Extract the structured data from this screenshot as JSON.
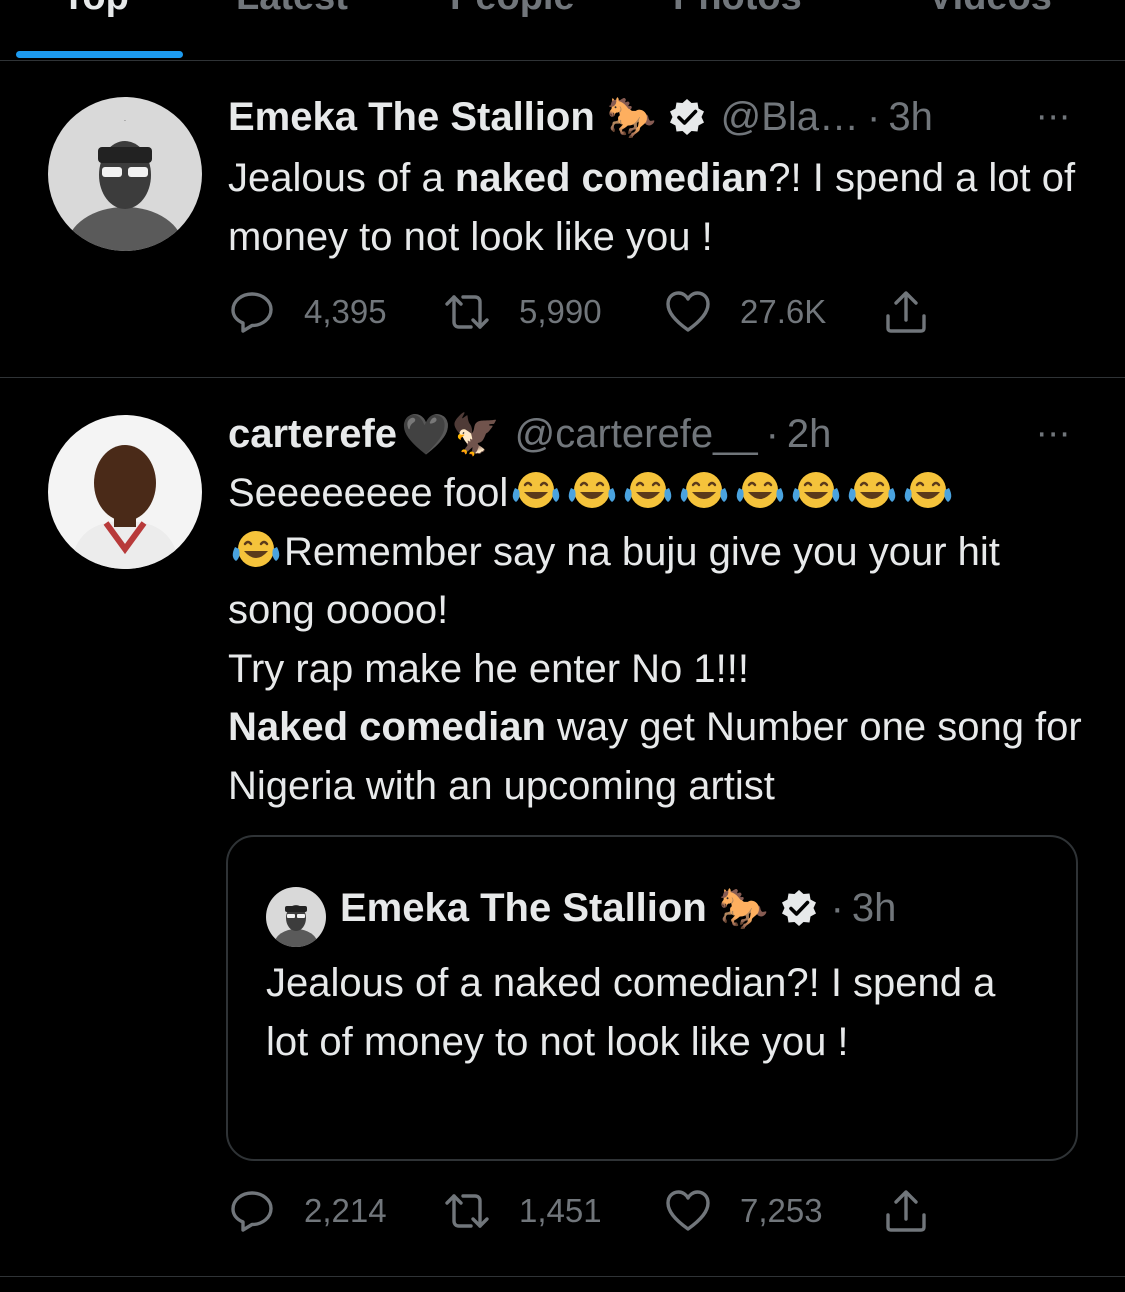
{
  "tabs": [
    {
      "label": "Top",
      "active": true
    },
    {
      "label": "Latest",
      "active": false
    },
    {
      "label": "People",
      "active": false
    },
    {
      "label": "Photos",
      "active": false
    },
    {
      "label": "Videos",
      "active": false
    }
  ],
  "colors": {
    "background": "#000000",
    "text_primary": "#e7e9ea",
    "text_secondary": "#71767b",
    "accent": "#1d9bf0",
    "divider": "#2f3336"
  },
  "tweets": [
    {
      "name": "Emeka The Stallion",
      "name_emoji": "🐎",
      "verified": true,
      "handle": "@Bla…",
      "dot": "·",
      "time": "3h",
      "more_icon": "⋯",
      "text_parts": [
        "Jealous of a ",
        "naked comedian",
        "?! I spend a lot of money to not look like you !"
      ],
      "replies": "4,395",
      "retweets": "5,990",
      "likes": "27.6K"
    },
    {
      "name": "carterefe",
      "name_emoji": "🖤🦅",
      "verified": false,
      "handle": "@carterefe__",
      "dot": "·",
      "time": "2h",
      "more_icon": "⋯",
      "text_parts": [
        "Seeeeeeee fool",
        "Remember say na buju give you your hit song ooooo!",
        "Try rap make he enter No 1!!!",
        "Naked comedian",
        " way get Number one song for Nigeria with an upcoming artist"
      ],
      "replies": "2,214",
      "retweets": "1,451",
      "likes": "7,253",
      "quoted": {
        "name": "Emeka The Stallion",
        "name_emoji": "🐎",
        "verified": true,
        "dot": "·",
        "time": "3h",
        "text": "Jealous of a naked comedian?! I spend a lot of money to not look like you !"
      }
    }
  ],
  "emoji": {
    "laughing": "😂",
    "count_line_one": 8
  }
}
